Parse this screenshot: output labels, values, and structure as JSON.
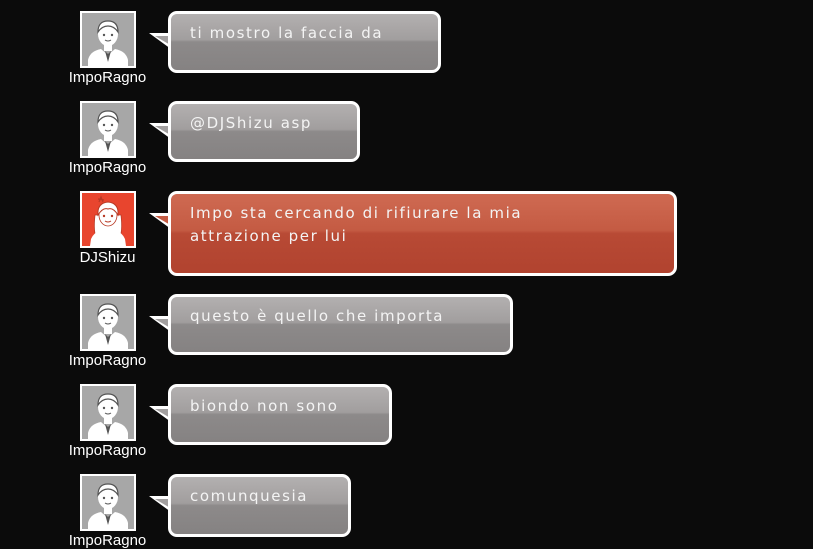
{
  "messages": [
    {
      "user": "ImpoRagno",
      "text": "ti mostro la faccia da",
      "style": "gray",
      "avatar": "male-user-icon"
    },
    {
      "user": "ImpoRagno",
      "text": "@DJShizu asp",
      "style": "gray",
      "avatar": "male-user-icon"
    },
    {
      "user": "DJShizu",
      "text": "Impo sta cercando di rifiurare la mia",
      "text2": "attrazione per lui",
      "style": "red",
      "avatar": "female-user-icon"
    },
    {
      "user": "ImpoRagno",
      "text": "questo è quello che importa",
      "style": "gray",
      "avatar": "male-user-icon"
    },
    {
      "user": "ImpoRagno",
      "text": "biondo non sono",
      "style": "gray",
      "avatar": "male-user-icon"
    },
    {
      "user": "ImpoRagno",
      "text": "comunquesia",
      "style": "gray",
      "avatar": "male-user-icon"
    }
  ],
  "colors": {
    "background": "#0b0b0b",
    "bubble_gray": "#a19e9e",
    "bubble_red": "#c45b43",
    "avatar_female_bg": "#e8452e",
    "avatar_male_bg": "#a7a7a7"
  }
}
